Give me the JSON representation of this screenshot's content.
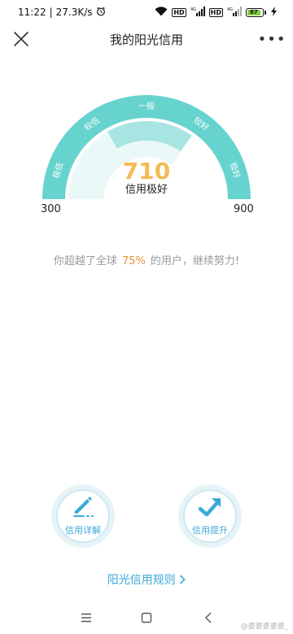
{
  "status_bar": {
    "time": "11:22",
    "separator": "|",
    "net_speed": "27.3K/s",
    "hd_badge_1": "HD",
    "net_1": "4G",
    "hd_badge_2": "HD",
    "net_2": "4G",
    "battery_level": "87",
    "icons": [
      "alarm-icon",
      "wifi-icon",
      "signal-icon",
      "charging-icon"
    ]
  },
  "header": {
    "title": "我的阳光信用",
    "more_label": "•••",
    "icons": [
      "close-icon",
      "more-icon"
    ]
  },
  "gauge": {
    "score": "710",
    "level": "信用极好",
    "min": "300",
    "max": "900",
    "score_fraction": 0.7,
    "segments": [
      "极低",
      "较低",
      "一般",
      "较好",
      "极好"
    ],
    "colors": {
      "outer": "#67d3cf",
      "inner_light": "#eaf8f7",
      "inner_strong": "#a8e4e1",
      "segment_text": "#ffffff"
    }
  },
  "summary": {
    "prefix": "你超越了全球",
    "percent": "75%",
    "suffix": "的用户，继续努力!",
    "percent_color": "#e8913c"
  },
  "actions": [
    {
      "label": "信用详解",
      "icon": "edit-icon"
    },
    {
      "label": "信用提升",
      "icon": "trend-up-icon"
    }
  ],
  "rules_link": {
    "label": "阳光信用规则",
    "icon": "chevron-right-icon"
  },
  "nav_bar": {
    "icons": [
      "menu-icon",
      "home-square-icon",
      "back-icon"
    ]
  },
  "watermark": "@婆婆婆婆婆_"
}
